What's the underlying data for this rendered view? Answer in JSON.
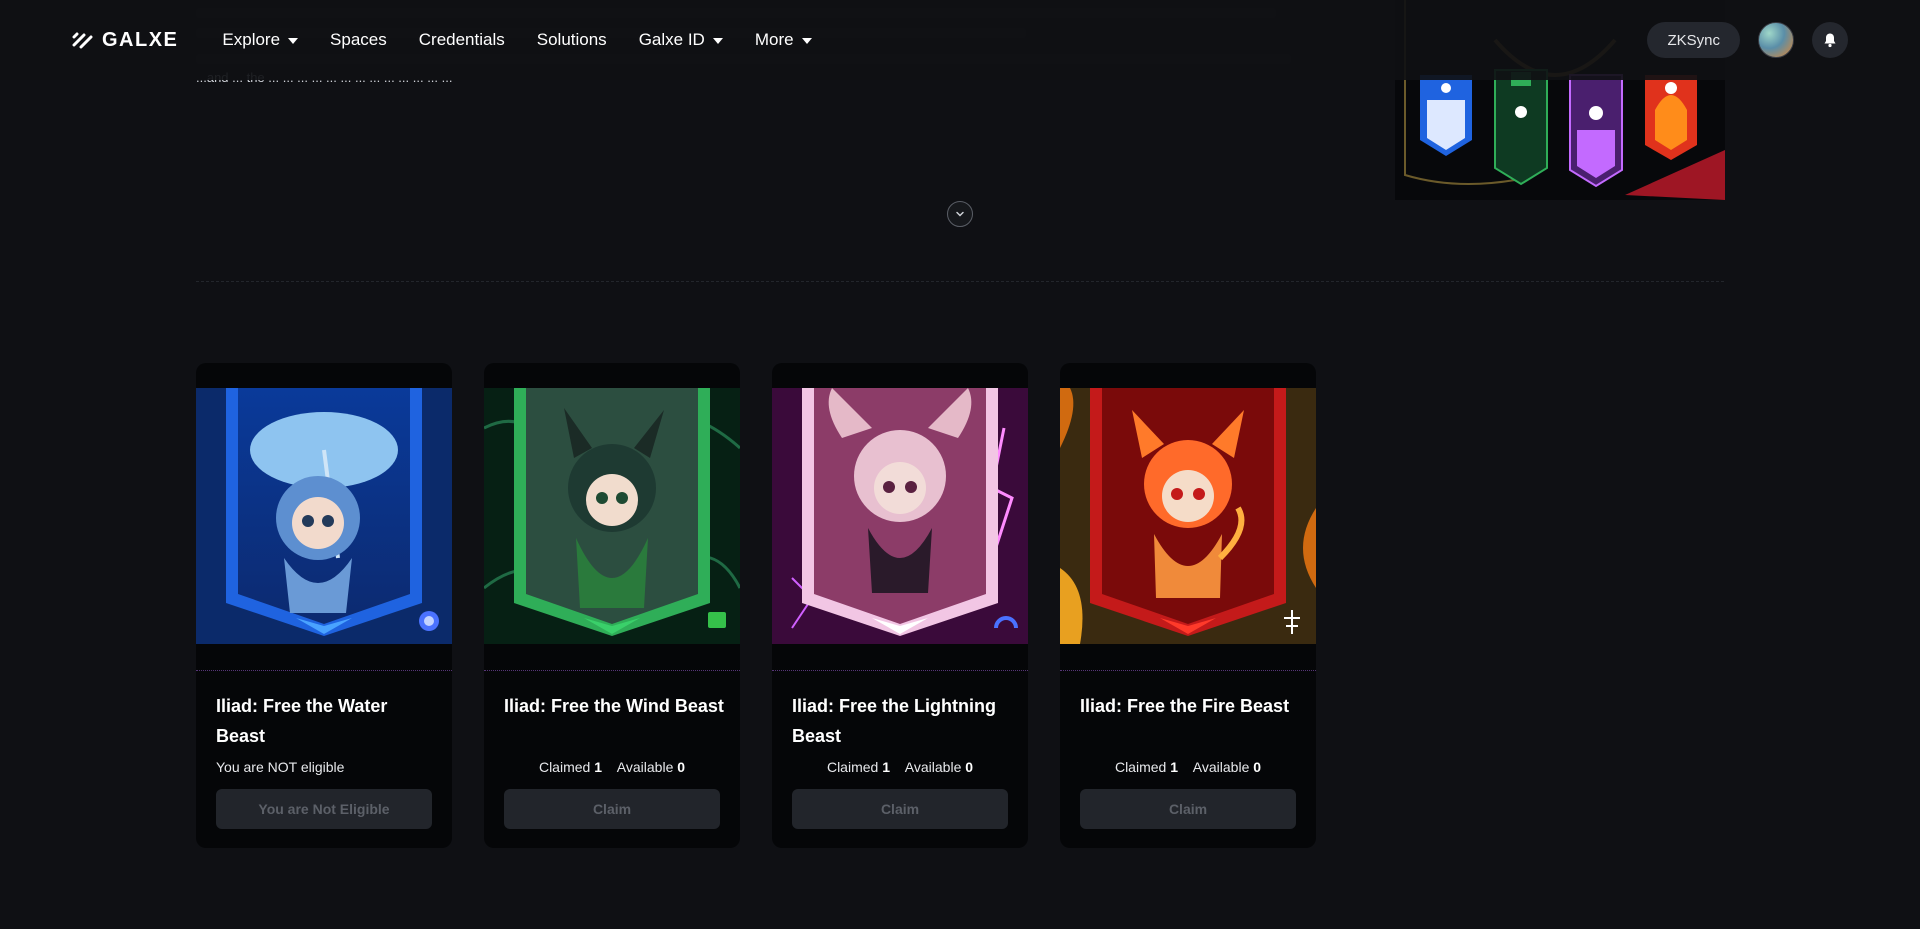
{
  "header": {
    "logo_text": "GALXE",
    "nav": [
      {
        "label": "Explore",
        "has_dropdown": true
      },
      {
        "label": "Spaces",
        "has_dropdown": false
      },
      {
        "label": "Credentials",
        "has_dropdown": false
      },
      {
        "label": "Solutions",
        "has_dropdown": false
      },
      {
        "label": "Galxe ID",
        "has_dropdown": true
      },
      {
        "label": "More",
        "has_dropdown": true
      }
    ],
    "network_label": "ZKSync",
    "icons": {
      "logo": "galxe-logo-icon",
      "bell": "bell-icon",
      "avatar": "avatar"
    }
  },
  "description": {
    "visible_fragment": "...and ... the ... ... ... ... ... ... ... ... ... ... ... ... ..."
  },
  "cards": [
    {
      "title": "Iliad: Free the Water Beast",
      "status": "You are NOT eligible",
      "button_label": "You are Not Eligible",
      "theme": "#1f5fe0",
      "badge_icon": "water-element-icon"
    },
    {
      "title": "Iliad: Free the Wind Beast",
      "claimed_label": "Claimed",
      "claimed": "1",
      "available_label": "Available",
      "available": "0",
      "button_label": "Claim",
      "theme": "#2fae58",
      "badge_icon": "wind-element-icon"
    },
    {
      "title": "Iliad: Free the Lightning Beast",
      "claimed_label": "Claimed",
      "claimed": "1",
      "available_label": "Available",
      "available": "0",
      "button_label": "Claim",
      "theme": "#c45a9a",
      "badge_icon": "lightning-element-icon"
    },
    {
      "title": "Iliad: Free the Fire Beast",
      "claimed_label": "Claimed",
      "claimed": "1",
      "available_label": "Available",
      "available": "0",
      "button_label": "Claim",
      "theme": "#c41a1a",
      "badge_icon": "fire-element-icon"
    }
  ]
}
